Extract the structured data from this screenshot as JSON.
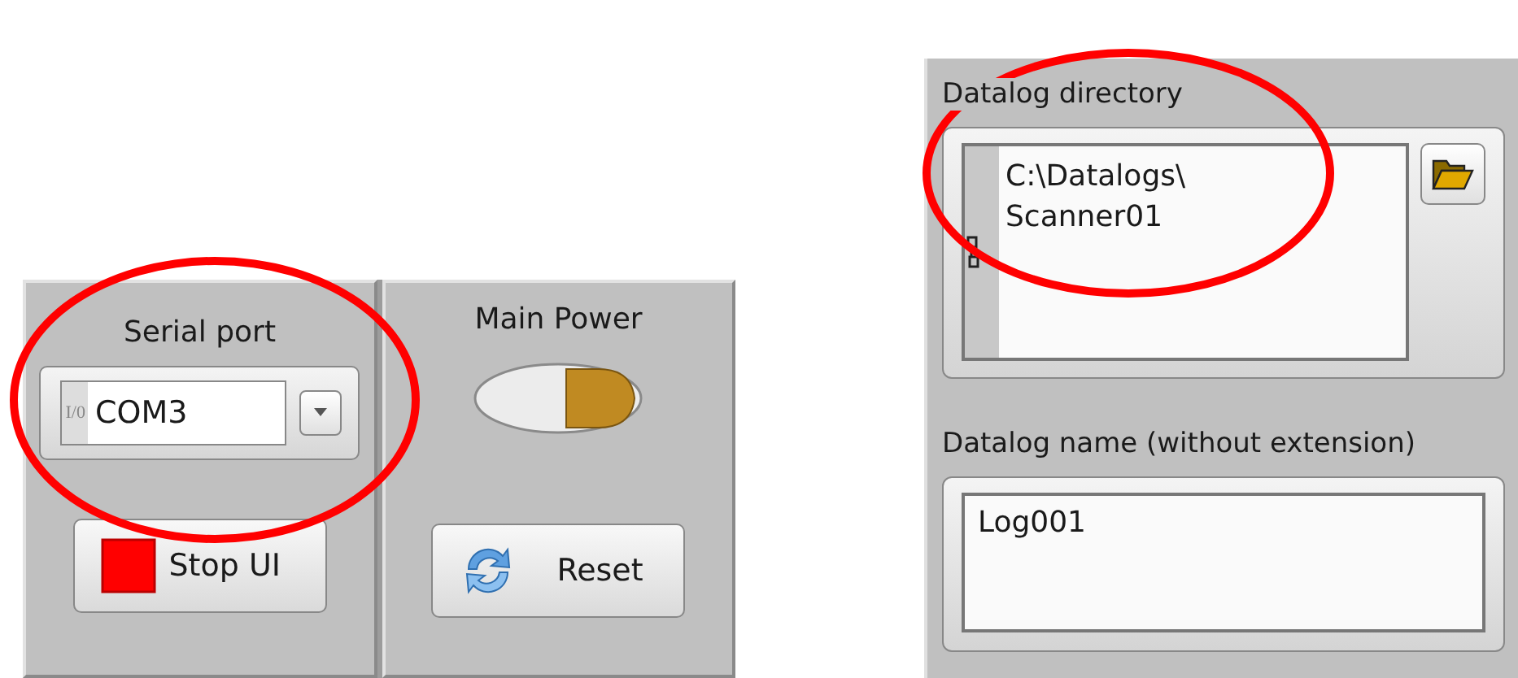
{
  "serial_port": {
    "label": "Serial port",
    "prefix": "I/0",
    "value": "COM3"
  },
  "stop_button": {
    "label": "Stop UI"
  },
  "main_power": {
    "label": "Main Power",
    "on": true
  },
  "reset_button": {
    "label": "Reset"
  },
  "datalog_directory": {
    "label": "Datalog directory",
    "value_lines": [
      "C:\\Datalogs\\",
      "Scanner01"
    ]
  },
  "datalog_name": {
    "label": "Datalog name (without extension)",
    "value": "Log001"
  },
  "annotations": [
    {
      "kind": "ellipse",
      "color": "#ff0000"
    },
    {
      "kind": "ellipse",
      "color": "#ff0000"
    }
  ]
}
